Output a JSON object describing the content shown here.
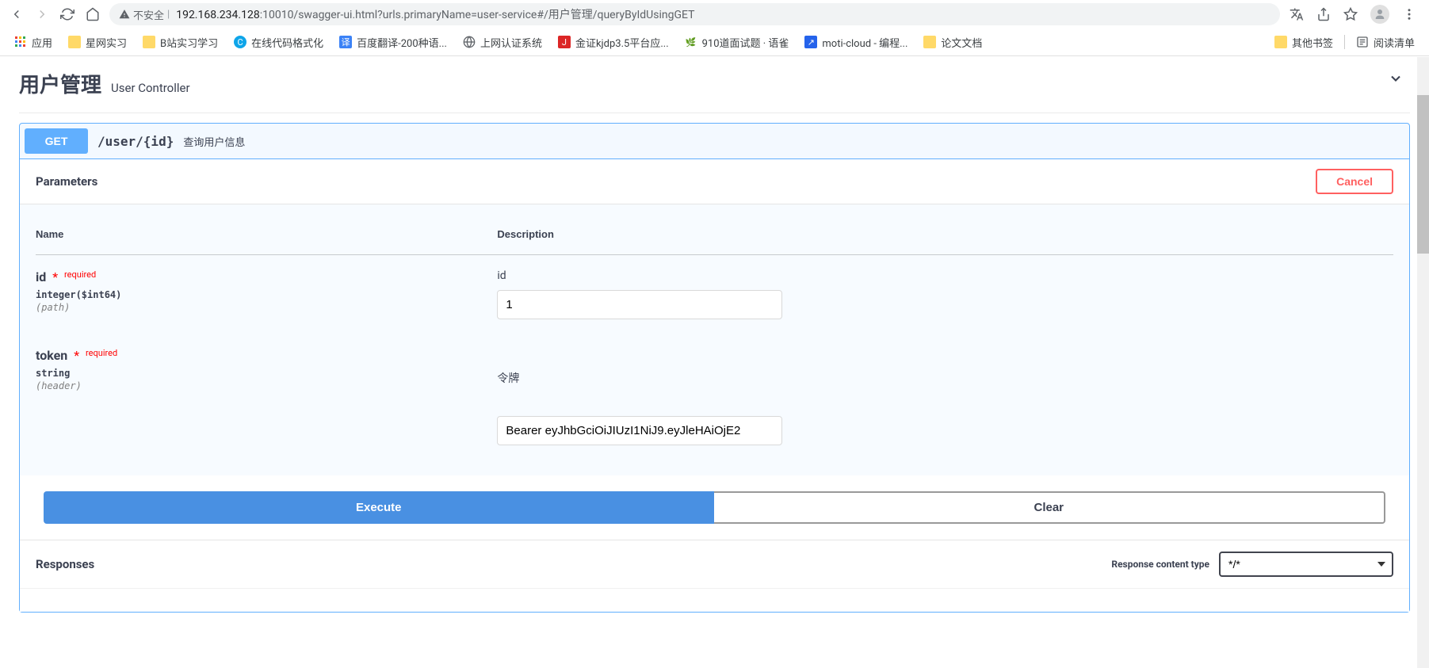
{
  "browser": {
    "insecure_label": "不安全",
    "url_host": "192.168.234.128",
    "url_rest": ":10010/swagger-ui.html?urls.primaryName=user-service#/用户管理/queryByIdUsingGET"
  },
  "bookmarks": {
    "apps": "应用",
    "items": [
      {
        "icon_type": "folder",
        "label": "星网实习"
      },
      {
        "icon_type": "folder",
        "label": "B站实习学习"
      },
      {
        "icon_type": "blue-c",
        "label": "在线代码格式化"
      },
      {
        "icon_type": "blue-yi",
        "label": "百度翻译-200种语..."
      },
      {
        "icon_type": "globe",
        "label": "上网认证系统"
      },
      {
        "icon_type": "red-j",
        "label": "金证kjdp3.5平台应..."
      },
      {
        "icon_type": "green",
        "label": "910道面试题 · 语雀"
      },
      {
        "icon_type": "blue-arrow",
        "label": "moti-cloud - 编程..."
      },
      {
        "icon_type": "folder",
        "label": "论文文档"
      }
    ],
    "other_bookmarks": "其他书签",
    "reading_list": "阅读清单"
  },
  "swagger": {
    "tag_name": "用户管理",
    "tag_desc": "User Controller",
    "method": "GET",
    "path": "/user/{id}",
    "op_desc": "查询用户信息",
    "parameters_title": "Parameters",
    "cancel_label": "Cancel",
    "col_name": "Name",
    "col_desc": "Description",
    "params": [
      {
        "name": "id",
        "required_label": "required",
        "type": "integer($int64)",
        "in": "(path)",
        "desc": "id",
        "value": "1"
      },
      {
        "name": "token",
        "required_label": "required",
        "type": "string",
        "in": "(header)",
        "desc": "令牌",
        "value": "Bearer eyJhbGciOiJIUzI1NiJ9.eyJleHAiOjE2"
      }
    ],
    "execute_label": "Execute",
    "clear_label": "Clear",
    "responses_title": "Responses",
    "content_type_label": "Response content type",
    "content_type_value": "*/*"
  }
}
